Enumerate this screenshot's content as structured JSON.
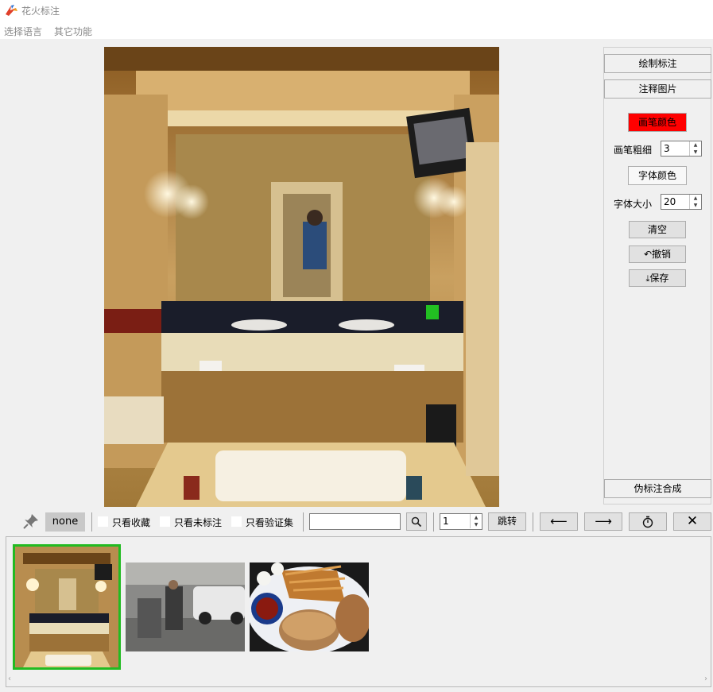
{
  "app": {
    "title": "花火标注"
  },
  "menu": {
    "items": [
      "选择语言",
      "其它功能"
    ]
  },
  "right_panel": {
    "draw_annotation": "绘制标注",
    "annotate_image": "注释图片",
    "pen_color": "画笔颜色",
    "pen_color_value": "#ff0000",
    "pen_width_label": "画笔粗细",
    "pen_width_value": "3",
    "font_color": "字体颜色",
    "font_size_label": "字体大小",
    "font_size_value": "20",
    "clear": "清空",
    "undo": "撤销",
    "save": "保存",
    "pseudo_label_merge": "伪标注合成"
  },
  "toolbar": {
    "class_badge": "none",
    "only_favorites": "只看收藏",
    "only_unlabeled": "只看未标注",
    "only_validation": "只看验证集",
    "search_value": "",
    "page_value": "1",
    "jump": "跳转",
    "prev_icon": "arrow-left-icon",
    "next_icon": "arrow-right-icon",
    "timer_icon": "stopwatch-icon",
    "close_icon": "close-icon"
  },
  "thumbnails": {
    "selected_border_color": "#22bb22"
  }
}
